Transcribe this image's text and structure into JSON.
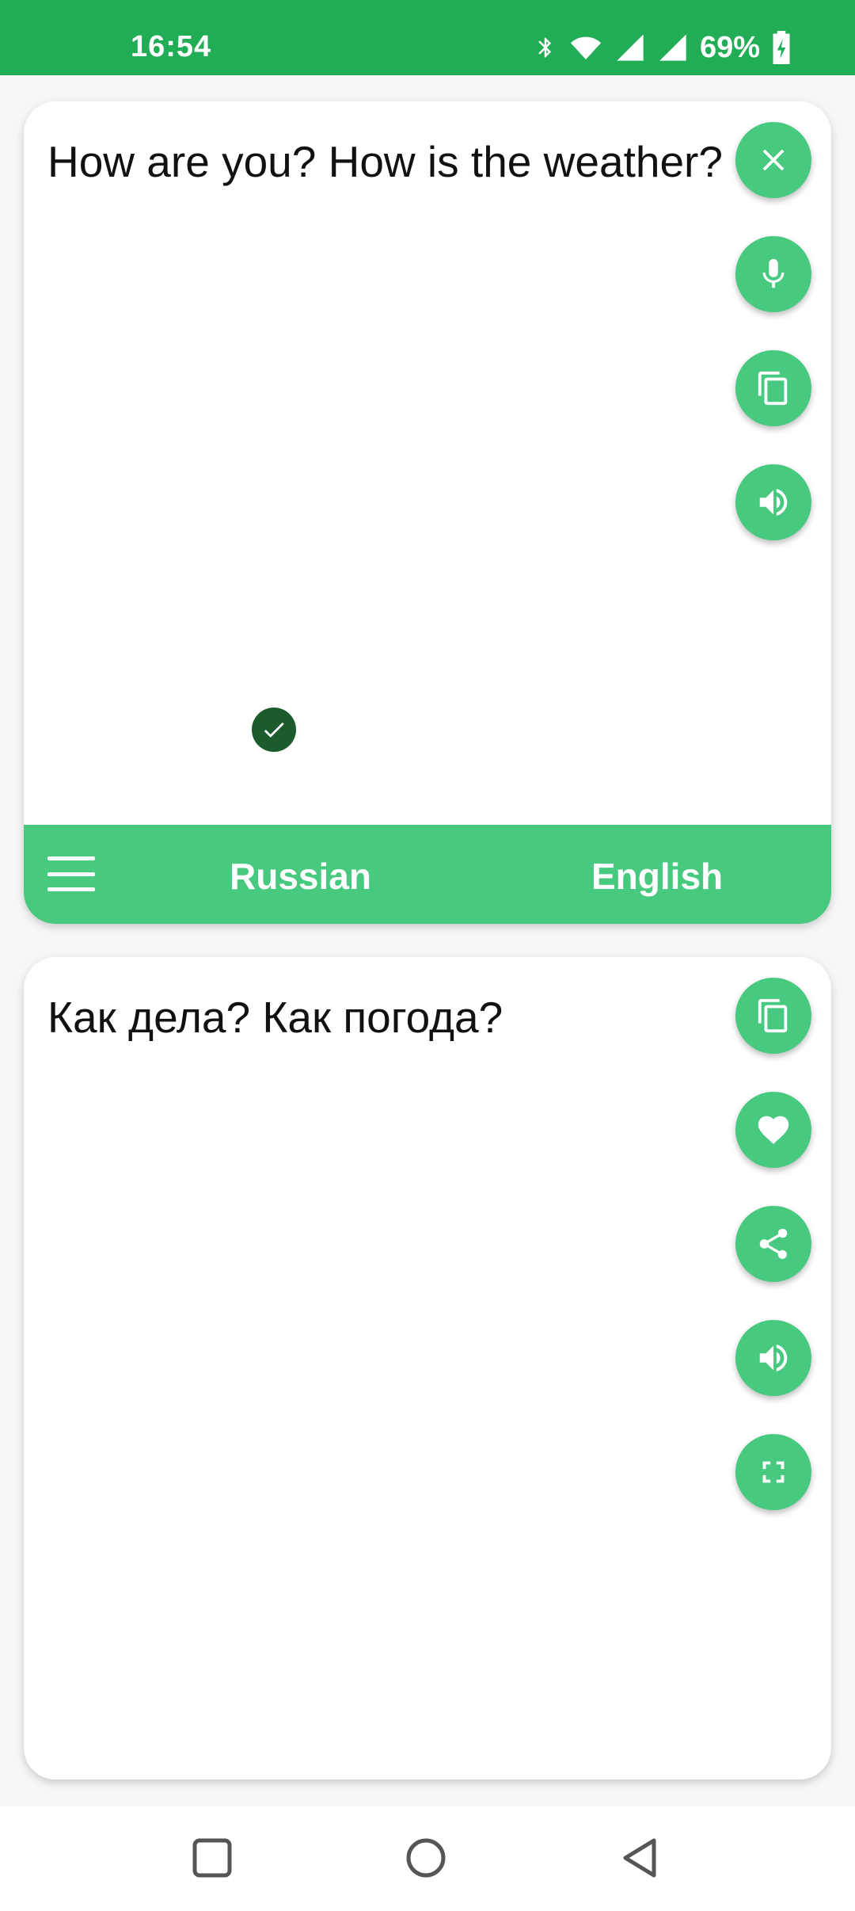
{
  "status_bar": {
    "time": "16:54",
    "battery": "69%",
    "icons": [
      "bluetooth-icon",
      "wifi-icon",
      "signal-icon",
      "signal-icon",
      "battery-charging-icon"
    ]
  },
  "input_panel": {
    "text": "How are you? How is the weather?",
    "buttons": [
      "close-icon",
      "microphone-icon",
      "copy-icon",
      "speaker-icon"
    ]
  },
  "language_bar": {
    "source_language": "Russian",
    "target_language": "English"
  },
  "output_panel": {
    "text": "Как дела? Как погода?",
    "buttons": [
      "copy-icon",
      "heart-icon",
      "share-icon",
      "speaker-icon",
      "fullscreen-icon"
    ]
  },
  "colors": {
    "status_bar": "#21ad55",
    "accent": "#47ca7f",
    "check_badge": "#1c5b2c"
  }
}
